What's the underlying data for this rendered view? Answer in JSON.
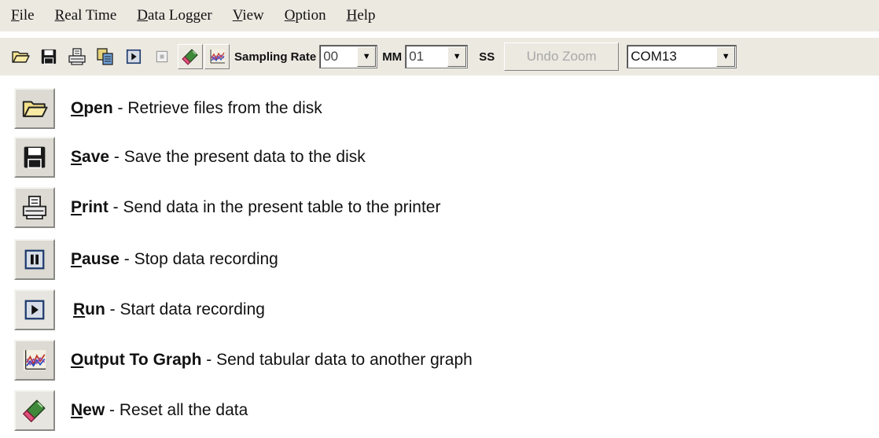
{
  "menubar": {
    "items": [
      {
        "mnemonic": "F",
        "rest": "ile"
      },
      {
        "mnemonic": "R",
        "rest": "eal Time"
      },
      {
        "mnemonic": "D",
        "rest": "ata Logger"
      },
      {
        "mnemonic": "V",
        "rest": "iew"
      },
      {
        "mnemonic": "O",
        "rest": "ption"
      },
      {
        "mnemonic": "H",
        "rest": "elp"
      }
    ]
  },
  "toolbar": {
    "sampling_rate_label": "Sampling Rate",
    "hh_value": "00",
    "mm_label": "MM",
    "mm_value": "01",
    "ss_label": "SS",
    "undo_zoom_label": "Undo Zoom",
    "port_value": "COM13"
  },
  "legend": {
    "items": [
      {
        "mnemonic": "O",
        "name_rest": "pen",
        "separator": " - ",
        "description": "Retrieve files from the disk",
        "icon": "open-folder-icon"
      },
      {
        "mnemonic": "S",
        "name_rest": "ave",
        "separator": " - ",
        "description": "Save the present data to the disk",
        "icon": "floppy-disk-icon"
      },
      {
        "mnemonic": "P",
        "name_rest": "rint",
        "separator": " - ",
        "description": "Send data in the present table to the printer",
        "icon": "printer-icon"
      },
      {
        "mnemonic": "P",
        "name_rest": "ause",
        "separator": " - ",
        "description": "Stop data recording",
        "icon": "pause-icon"
      },
      {
        "mnemonic": "R",
        "name_rest": "un",
        "separator": " - ",
        "description": "Start data recording",
        "icon": "play-icon"
      },
      {
        "mnemonic": "O",
        "name_rest": "utput To Graph",
        "separator": " - ",
        "description": "Send tabular data to another graph",
        "icon": "graph-icon"
      },
      {
        "mnemonic": "N",
        "name_rest": "ew",
        "separator": " - ",
        "description": "Reset all the data",
        "icon": "eraser-icon"
      }
    ]
  },
  "colors": {
    "chrome": "#ece9e1",
    "folder": "#f3e08a",
    "eraser_pink": "#e0507a",
    "graph_red": "#c0392b",
    "graph_blue": "#2b4fc0"
  }
}
